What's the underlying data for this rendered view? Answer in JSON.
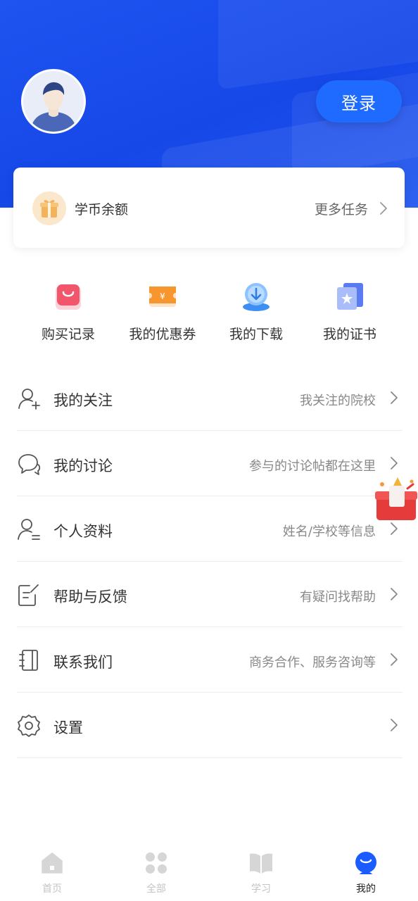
{
  "header": {
    "login_label": "登录"
  },
  "coins": {
    "label": "学币余额",
    "more": "更多任务"
  },
  "quick_actions": [
    {
      "label": "购买记录",
      "icon": "shopping-bag-icon"
    },
    {
      "label": "我的优惠券",
      "icon": "coupon-icon"
    },
    {
      "label": "我的下载",
      "icon": "cloud-download-icon"
    },
    {
      "label": "我的证书",
      "icon": "certificate-icon"
    }
  ],
  "menu": [
    {
      "label": "我的关注",
      "hint": "我关注的院校",
      "icon": "user-add-icon"
    },
    {
      "label": "我的讨论",
      "hint": "参与的讨论帖都在这里",
      "icon": "chat-icon"
    },
    {
      "label": "个人资料",
      "hint": "姓名/学校等信息",
      "icon": "user-profile-icon"
    },
    {
      "label": "帮助与反馈",
      "hint": "有疑问找帮助",
      "icon": "edit-note-icon"
    },
    {
      "label": "联系我们",
      "hint": "商务合作、服务咨询等",
      "icon": "contacts-book-icon"
    },
    {
      "label": "设置",
      "hint": "",
      "icon": "gear-icon"
    }
  ],
  "tabbar": [
    {
      "label": "首页",
      "icon": "home-icon",
      "active": false
    },
    {
      "label": "全部",
      "icon": "grid-icon",
      "active": false
    },
    {
      "label": "学习",
      "icon": "book-icon",
      "active": false
    },
    {
      "label": "我的",
      "icon": "profile-icon",
      "active": true
    }
  ],
  "colors": {
    "header_blue": "#1648e8",
    "button_blue": "#1f6bff",
    "tab_active": "#1a5cff"
  }
}
